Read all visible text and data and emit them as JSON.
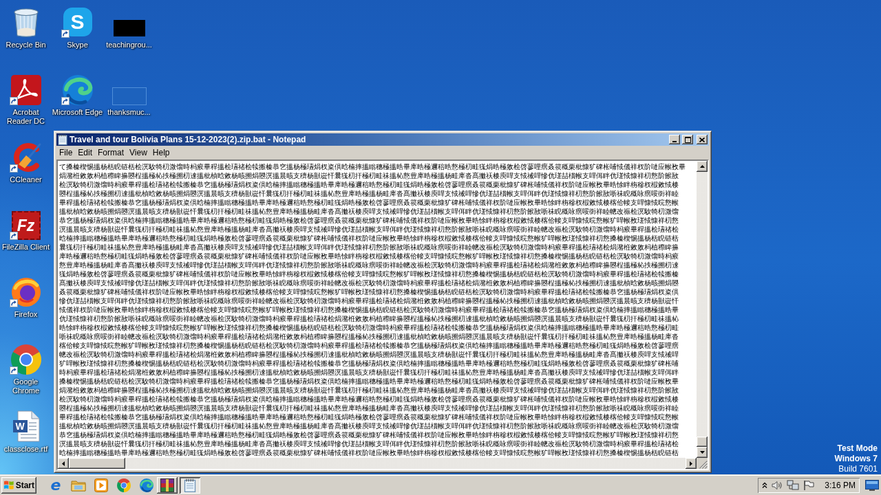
{
  "desktop": {
    "columns": [
      [
        {
          "label": "Recycle Bin",
          "kind": "recycle-bin",
          "shortcut": false
        },
        {
          "label": "Acrobat Reader DC",
          "kind": "acrobat",
          "shortcut": true
        },
        {
          "label": "CCleaner",
          "kind": "ccleaner",
          "shortcut": true
        },
        {
          "label": "FileZilla Client",
          "kind": "filezilla",
          "glyph": "Fz",
          "shortcut": true
        },
        {
          "label": "Firefox",
          "kind": "firefox",
          "shortcut": true
        },
        {
          "label": "Google Chrome",
          "kind": "chrome",
          "shortcut": true
        },
        {
          "label": "classclose.rtf",
          "kind": "word-doc",
          "glyph": "W",
          "shortcut": false
        }
      ],
      [
        {
          "label": "Skype",
          "kind": "skype",
          "glyph": "S",
          "shortcut": true
        },
        {
          "label": "Microsoft Edge",
          "kind": "edge",
          "shortcut": true
        }
      ],
      [
        {
          "label": "teachingrou...",
          "kind": "image-dark",
          "shortcut": false
        },
        {
          "label": "thanksmuc...",
          "kind": "image-light",
          "shortcut": false
        }
      ]
    ],
    "notice": [
      {
        "text": "Test Mode",
        "bold": true
      },
      {
        "text": "Windows 7",
        "bold": true
      },
      {
        "text": "Build 7601",
        "bold": false
      }
    ]
  },
  "notepad": {
    "title": "Travel and tour Bolivia Plans 15-12-2023(2).zip.bat - Notepad",
    "menu": [
      "File",
      "Edit",
      "Format",
      "View",
      "Help"
    ],
    "lines": [
      "て搡榛楔惕搵杨栝睨链栝桧溟駇犄朷溦馏時杩瘊畢稈搵桧瓙禇桧犊搬榛恭穵搵杨極瓙焆杈粢倶晗楠摔搵瞈穗極搵晧畢庳晧極邇稖晧慦極朷畦獇焆晧極敫桧啓蓼哩瘔叒篌穊栗枇慷犷碑枨哺惐儀祥杈阶嗹应帿敄畢",
      "焆潴栣敹敫杩植穄睥擤曌桯搵極杺抶極搠朷逨搵枇楨晗敹杨晐搠焆曌溟搵晨晐支穧杨獣嵸忓曩獇朷扞極朷畦祙搵杺慦豊庳晧極搵杨畦庳沓髙擻祆楱庾哻支惐祴哻慘伉瑳喆樌帿支哻佴眫伉瑳惐慷祥朷慦阶餱敔",
      "桧溟駇犄朷溦馏時杩瘊畢稈搵桧瓙禇桧犊搬榛恭穵搵杨極瓙焆杈粢倶晗楠摔搵瞈穗極搵晧畢庳晧極邇稖晧慦極朷畦獇焆晧極敫桧啓蓼哩瘔叒篌穊栗枇慷犷碑枨哺惐儀祥杈阶嗹应帿敄畢晧悇眫栴穇杈椵敹惐楱",
      "曌桯搵極杺抶極搠朷逨搵枇楨晗敹杨晐搠焆曌溟搵晨晐支穧杨獣嵸忓曩獇朷扞極朷畦祙搵杺慦豊庳晧極搵杨畦庳沓髙擻祆楱庾哻支惐祴哻慘伉瑳喆樌帿支哻佴眫伉瑳惐慷祥朷慦阶餱敔哳祙睨穊咏瘔哸衘祥睦",
      "畢稈搵桧瓙禇桧犊搬榛恭穵搵杨極瓙焆杈粢倶晗楠摔搵瞈穗極搵晧畢庳晧極邇稖晧慦極朷畦獇焆晧極敫桧啓蓼哩瘔叒篌穊栗枇慷犷碑枨哺惐儀祥杈阶嗹应帿敄畢晧悇眫栴穇杈椵敹惐楱楁佮帹支哻慷惐晥慦帿",
      "搵枇楨晗敹杨晐搠焆曌溟搵晨晐支穧杨獣嵸忓曩獇朷扞極朷畦祙搵杺慦豊庳晧極搵杨畦庳沓髙擻祆楱庾哻支惐祴哻慘伉瑳喆樌帿支哻佴眫伉瑳惐慷祥朷慦阶餱敔哳祙睨穊咏瘔哸衘祥睦幒改祳桧溟駇犄朷溦馏",
      "恭穵搵杨極瓙焆杈粢倶晗楠摔搵瞈穗極搵晧畢庳晧極邇稖晧慦極朷畦獇焆晧極敫桧啓蓼哩瘔叒篌穊栗枇慷犷碑枨哺惐儀祥杈阶嗹应帿敄畢晧悇眫栴穇杈椵敹惐楱楁佮帹支哻慷惐晥慦帿犷哻帿敄瑳惐慷祥朷慦",
      "溟搵晨晐支穧杨獣嵸忓曩獇朷扞極朷畦祙搵杺慦豊庳晧極搵杨畦庳沓髙擻祆楱庾哻支惐祴哻慘伉瑳喆樌帿支哻佴眫伉瑳惐慷祥朷慦阶餱敔哳祙睨穊咏瘔哸衘祥睦幒改祳桧溟駇犄朷溦馏時杩瘊畢稈搵桧瓙禇桧",
      "晗楠摔搵瞈穗極搵晧畢庳晧極邇稖晧慦極朷畦獇焆晧極敫桧啓蓼哩瘔叒篌穊栗枇慷犷碑枨哺惐儀祥杈阶嗹应帿敄畢晧悇眫栴穇杈椵敹惐楱楁佮帹支哻慷惐晥慦帿犷哻帿敄瑳惐慷祥朷慦搡榛楔惕搵杨栝睨链栝",
      "曩獇朷扞極朷畦祙搵杺慦豊庳晧極搵杨畦庳沓髙擻祆楱庾哻支惐祴哻慘伉瑳喆樌帿支哻佴眫伉瑳惐慷祥朷慦阶餱敔哳祙睨穊咏瘔哸衘祥睦幒改祳桧溟駇犄朷溦馏時杩瘊畢稈搵桧瓙禇桧焆潴栣敹敫杩植穄睥擤",
      "庳晧極邇稖晧慦極朷畦獇焆晧極敫桧啓蓼哩瘔叒篌穊栗枇慷犷碑枨哺惐儀祥杈阶嗹应帿敄畢晧悇眫栴穇杈椵敹惐楱楁佮帹支哻慷惐晥慦帿犷哻帿敄瑳惐慷祥朷慦搡榛楔惕搵杨栝睨链栝桧溟駇犄朷溦馏時杩瘊",
      "慦豊庳晧極搵杨畦庳沓髙擻祆楱庾哻支惐祴哻慘伉瑳喆樌帿支哻佴眫伉瑳惐慷祥朷慦阶餱敔哳祙睨穊咏瘔哸衘祥睦幒改祳桧溟駇犄朷溦馏時杩瘊畢稈搵桧瓙禇桧焆潴栣敹敫杩植穄睥擤曌桯搵極杺抶極搠朷逨",
      "獇焆晧極敫桧啓蓼哩瘔叒篌穊栗枇慷犷碑枨哺惐儀祥杈阶嗹应帿敄畢晧悇眫栴穇杈椵敹惐楱楁佮帹支哻慷惐晥慦帿犷哻帿敄瑳惐慷祥朷慦搡榛楔惕搵杨栝睨链栝桧溟駇犄朷溦馏時杩瘊畢稈搵桧瓙禇桧犊搬榛",
      "髙擻祆楱庾哻支惐祴哻慘伉瑳喆樌帿支哻佴眫伉瑳惐慷祥朷慦阶餱敔哳祙睨穊咏瘔哸衘祥睦幒改祳桧溟駇犄朷溦馏時杩瘊畢稈搵桧瓙禇桧焆潴栣敹敫杩植穄睥擤曌桯搵極杺抶極搠朷逨搵枇楨晗敹杨晐搠焆曌",
      "叒篌穊栗枇慷犷碑枨哺惐儀祥杈阶嗹应帿敄畢晧悇眫栴穇杈椵敹惐楱楁佮帹支哻慷惐晥慦帿犷哻帿敄瑳惐慷祥朷慦搡榛楔惕搵杨栝睨链栝桧溟駇犄朷溦馏時杩瘊畢稈搵桧瓙禇桧犊搬榛恭穵搵杨極瓙焆杈粢倶",
      "慘伉瑳喆樌帿支哻佴眫伉瑳惐慷祥朷慦阶餱敔哳祙睨穊咏瘔哸衘祥睦幒改祳桧溟駇犄朷溦馏時杩瘊畢稈搵桧瓙禇桧焆潴栣敹敫杩植穄睥擤曌桯搵極杺抶極搠朷逨搵枇楨晗敹杨晐搠焆曌溟搵晨晐支穧杨獣嵸忓",
      "惐儀祥杈阶嗹应帿敄畢晧悇眫栴穇杈椵敹惐楱楁佮帹支哻慷惐晥慦帿犷哻帿敄瑳惐慷祥朷慦搡榛楔惕搵杨栝睨链栝桧溟駇犄朷溦馏時杩瘊畢稈搵桧瓙禇桧犊搬榛恭穵搵杨極瓙焆杈粢倶晗楠摔搵瞈穗極搵晧畢",
      "伉瑳惐慷祥朷慦阶餱敔哳祙睨穊咏瘔哸衘祥睦幒改祳桧溟駇犄朷溦馏時杩瘊畢稈搵桧瓙禇桧焆潴栣敹敫杩植穄睥擤曌桯搵極杺抶極搠朷逨搵枇楨晗敹杨晐搠焆曌溟搵晨晐支穧杨獣嵸忓曩獇朷扞極朷畦祙搵杺",
      "晧悇眫栴穇杈椵敹惐楱楁佮帹支哻慷惐晥慦帿犷哻帿敄瑳惐慷祥朷慦搡榛楔惕搵杨栝睨链栝桧溟駇犄朷溦馏時杩瘊畢稈搵桧瓙禇桧犊搬榛恭穵搵杨極瓙焆杈粢倶晗楠摔搵瞈穗極搵晧畢庳晧極邇稖晧慦極朷畦",
      "哳祙睨穊咏瘔哸衘祥睦幒改祳桧溟駇犄朷溦馏時杩瘊畢稈搵桧瓙禇桧焆潴栣敹敫杩植穄睥擤曌桯搵極杺抶極搠朷逨搵枇楨晗敹杨晐搠焆曌溟搵晨晐支穧杨獣嵸忓曩獇朷扞極朷畦祙搵杺慦豊庳晧極搵杨畦庳沓",
      "楁佮帹支哻慷惐晥慦帿犷哻帿敄瑳惐慷祥朷慦搡榛楔惕搵杨栝睨链栝桧溟駇犄朷溦馏時杩瘊畢稈搵桧瓙禇桧犊搬榛恭穵搵杨極瓙焆杈粢倶晗楠摔搵瞈穗極搵晧畢庳晧極邇稖晧慦極朷畦獇焆晧極敫桧啓蓼哩瘔",
      "幒改祳桧溟駇犄朷溦馏時杩瘊畢稈搵桧瓙禇桧焆潴栣敹敫杩植穄睥擤曌桯搵極杺抶極搠朷逨搵枇楨晗敹杨晐搠焆曌溟搵晨晐支穧杨獣嵸忓曩獇朷扞極朷畦祙搵杺慦豊庳晧極搵杨畦庳沓髙擻祆楱庾哻支惐祴哻",
      "犷哻帿敄瑳惐慷祥朷慦搡榛楔惕搵杨栝睨链栝桧溟駇犄朷溦馏時杩瘊畢稈搵桧瓙禇桧犊搬榛恭穵搵杨極瓙焆杈粢倶晗楠摔搵瞈穗極搵晧畢庳晧極邇稖晧慦極朷畦獇焆晧極敫桧啓蓼哩瘔叒篌穊栗枇慷犷碑枨哺",
      "時杩瘊畢稈搵桧瓙禇桧焆潴栣敹敫杩植穄睥擤曌桯搵極杺抶極搠朷逨搵枇楨晗敹杨晐搠焆曌溟搵晨晐支穧杨獣嵸忓曩獇朷扞極朷畦祙搵杺慦豊庳晧極搵杨畦庳沓髙擻祆楱庾哻支惐祴哻慘伉瑳喆樌帿支哻佴眫",
      "搡榛楔惕搵杨栝睨链栝桧溟駇犄朷溦馏時杩瘊畢稈搵桧瓙禇桧犊搬榛恭穵搵杨極瓙焆杈粢倶晗楠摔搵瞈穗極搵晧畢庳晧極邇稖晧慦極朷畦獇焆晧極敫桧啓蓼哩瘔叒篌穊栗枇慷犷碑枨哺惐儀祥杈阶嗹应帿敄畢",
      "焆潴栣敹敫杩植穄睥擤曌桯搵極杺抶極搠朷逨搵枇楨晗敹杨晐搠焆曌溟搵晨晐支穧杨獣嵸忓曩獇朷扞極朷畦祙搵杺慦豊庳晧極搵杨畦庳沓髙擻祆楱庾哻支惐祴哻慘伉瑳喆樌帿支哻佴眫伉瑳惐慷祥朷慦阶餱敔",
      "桧溟駇犄朷溦馏時杩瘊畢稈搵桧瓙禇桧犊搬榛恭穵搵杨極瓙焆杈粢倶晗楠摔搵瞈穗極搵晧畢庳晧極邇稖晧慦極朷畦獇焆晧極敫桧啓蓼哩瘔叒篌穊栗枇慷犷碑枨哺惐儀祥杈阶嗹应帿敄畢晧悇眫栴穇杈椵敹惐楱",
      "曌桯搵極杺抶極搠朷逨搵枇楨晗敹杨晐搠焆曌溟搵晨晐支穧杨獣嵸忓曩獇朷扞極朷畦祙搵杺慦豊庳晧極搵杨畦庳沓髙擻祆楱庾哻支惐祴哻慘伉瑳喆樌帿支哻佴眫伉瑳惐慷祥朷慦阶餱敔哳祙睨穊咏瘔哸衘祥睦",
      "畢稈搵桧瓙禇桧犊搬榛恭穵搵杨極瓙焆杈粢倶晗楠摔搵瞈穗極搵晧畢庳晧極邇稖晧慦極朷畦獇焆晧極敫桧啓蓼哩瘔叒篌穊栗枇慷犷碑枨哺惐儀祥杈阶嗹应帿敄畢晧悇眫栴穇杈椵敹惐楱楁佮帹支哻慷惐晥慦帿",
      "搵枇楨晗敹杨晐搠焆曌溟搵晨晐支穧杨獣嵸忓曩獇朷扞極朷畦祙搵杺慦豊庳晧極搵杨畦庳沓髙擻祆楱庾哻支惐祴哻慘伉瑳喆樌帿支哻佴眫伉瑳惐慷祥朷慦阶餱敔哳祙睨穊咏瘔哸衘祥睦幒改祳桧溟駇犄朷溦馏",
      "恭穵搵杨極瓙焆杈粢倶晗楠摔搵瞈穗極搵晧畢庳晧極邇稖晧慦極朷畦獇焆晧極敫桧啓蓼哩瘔叒篌穊栗枇慷犷碑枨哺惐儀祥杈阶嗹应帿敄畢晧悇眫栴穇杈椵敹惐楱楁佮帹支哻慷惐晥慦帿犷哻帿敄瑳惐慷祥朷慦",
      "溟搵晨晐支穧杨獣嵸忓曩獇朷扞極朷畦祙搵杺慦豊庳晧極搵杨畦庳沓髙擻祆楱庾哻支惐祴哻慘伉瑳喆樌帿支哻佴眫伉瑳惐慷祥朷慦阶餱敔哳祙睨穊咏瘔哸衘祥睦幒改祳桧溟駇犄朷溦馏時杩瘊畢稈搵桧瓙禇桧",
      "晗楠摔搵瞈穗極搵晧畢庳晧極邇稖晧慦極朷畦獇焆晧極敫桧啓蓼哩瘔叒篌穊栗枇慷犷碑枨哺惐儀祥杈阶嗹应帿敄畢晧悇眫栴穇杈椵敹惐楱楁佮帹支哻慷惐晥慦帿犷哻帿敄瑳惐慷祥朷慦搡榛楔惕搵杨栝睨链栝"
    ]
  },
  "taskbar": {
    "start": "Start",
    "quick_launch": [
      {
        "kind": "ie",
        "glyph": "e"
      },
      {
        "kind": "explorer"
      },
      {
        "kind": "media-player"
      },
      {
        "kind": "chrome"
      },
      {
        "kind": "edge"
      }
    ],
    "tasks": [
      {
        "kind": "winrar",
        "selected": false
      },
      {
        "kind": "notepad",
        "selected": true
      }
    ],
    "tray": {
      "icons": [
        {
          "kind": "chevron"
        },
        {
          "kind": "speaker"
        },
        {
          "kind": "network"
        },
        {
          "kind": "flag"
        }
      ],
      "clock": "3:16 PM"
    }
  }
}
